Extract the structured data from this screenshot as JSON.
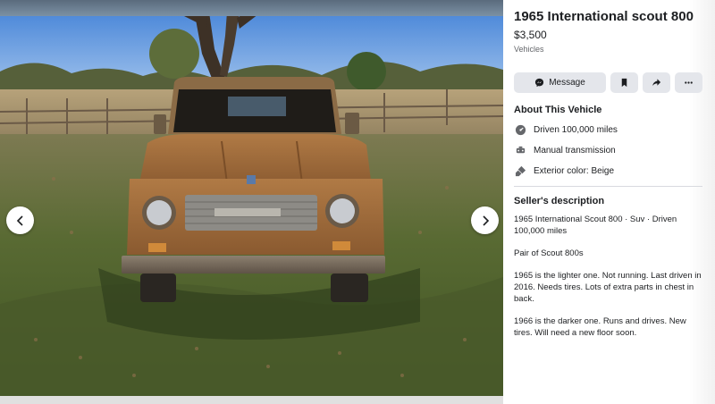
{
  "listing": {
    "title": "1965 International scout 800",
    "price": "$3,500",
    "category": "Vehicles"
  },
  "actions": {
    "message_label": "Message"
  },
  "about": {
    "heading": "About This Vehicle",
    "items": [
      {
        "label": "Driven 100,000 miles",
        "icon": "speedometer-icon"
      },
      {
        "label": "Manual transmission",
        "icon": "transmission-icon"
      },
      {
        "label": "Exterior color: Beige",
        "icon": "paint-brush-icon"
      }
    ]
  },
  "seller": {
    "heading": "Seller's description",
    "paragraphs": [
      "1965 International Scout 800 · Suv · Driven 100,000 miles",
      "Pair of Scout 800s",
      "1965 is the lighter one. Not running. Last driven in 2016. Needs tires. Lots of extra parts in chest in back.",
      "1966 is the darker one.  Runs and drives. New tires. Will need a new floor soon."
    ]
  },
  "photo": {
    "grille_badge": "INTERNATIONAL"
  },
  "colors": {
    "text_primary": "#1c1e21",
    "text_secondary": "#65676b",
    "button_bg": "#e4e6eb"
  }
}
